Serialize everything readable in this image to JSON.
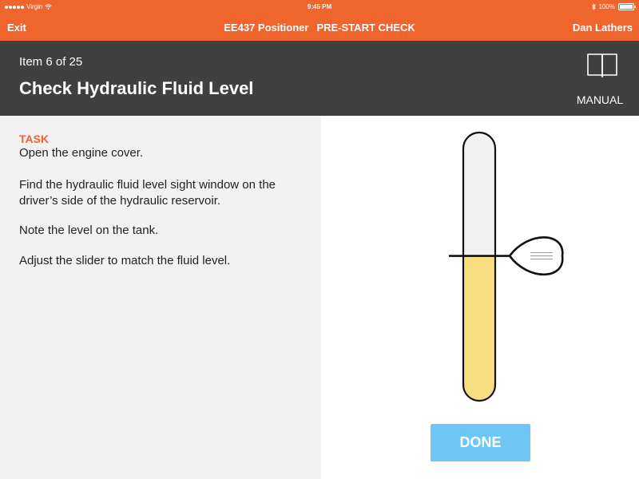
{
  "status_bar": {
    "carrier": "Virgin",
    "time": "9:45 PM",
    "battery": "100%"
  },
  "nav": {
    "exit_label": "Exit",
    "equipment": "EE437 Positioner",
    "check_name": "PRE-START CHECK",
    "user_name": "Dan Lathers"
  },
  "header": {
    "item_count": "Item 6 of 25",
    "title": "Check Hydraulic Fluid Level",
    "manual_label": "MANUAL"
  },
  "task": {
    "heading": "TASK",
    "lines": [
      "Open the engine cover.",
      "Find the hydraulic fluid level sight window on the driver’s side of the hydraulic reservoir.",
      "Note the level on the tank.",
      "Adjust the slider to match the fluid level."
    ]
  },
  "gauge": {
    "fluid_level": 0.54,
    "colors": {
      "fluid": "#f8de80",
      "empty": "#f2f2f2",
      "outline": "#111111"
    }
  },
  "done_label": "DONE",
  "colors": {
    "accent": "#f0642d",
    "header_bg": "#404040",
    "done_button": "#6fc5f5"
  }
}
